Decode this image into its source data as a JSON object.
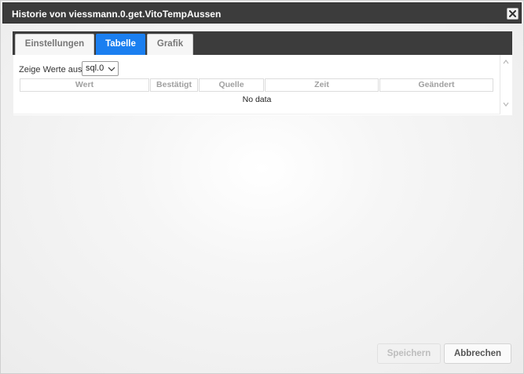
{
  "dialog": {
    "title": "Historie von viessmann.0.get.VitoTempAussen",
    "close_icon": "close-icon"
  },
  "tabs": [
    {
      "label": "Einstellungen",
      "active": false
    },
    {
      "label": "Tabelle",
      "active": true
    },
    {
      "label": "Grafik",
      "active": false
    }
  ],
  "table_panel": {
    "show_values_label": "Zeige Werte aus",
    "instance_select": {
      "value": "sql.0"
    },
    "columns": [
      "Wert",
      "Bestätigt",
      "Quelle",
      "Zeit",
      "Geändert"
    ],
    "empty_message": "No data"
  },
  "footer": {
    "save_label": "Speichern",
    "cancel_label": "Abbrechen"
  },
  "colors": {
    "titlebar": "#3c3c3c",
    "active_tab": "#1b7ff0"
  }
}
